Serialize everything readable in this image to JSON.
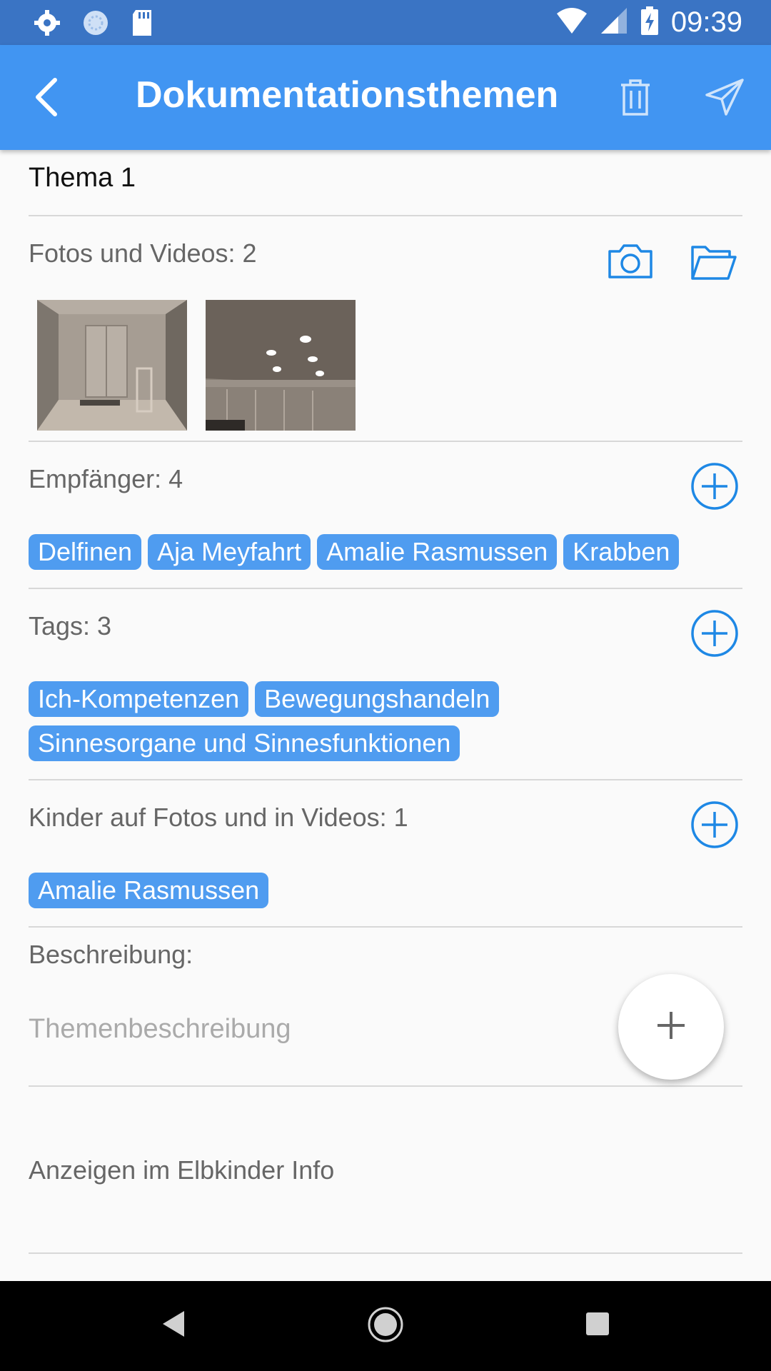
{
  "status_bar": {
    "time": "09:39",
    "icons": [
      "gear-icon",
      "sync-icon",
      "sdcard-icon",
      "wifi-icon",
      "signal-icon",
      "battery-charging-icon"
    ]
  },
  "app_bar": {
    "title": "Dokumentationsthemen",
    "icons": [
      "back-arrow-icon",
      "trash-icon",
      "send-icon"
    ]
  },
  "topic": {
    "title": "Thema 1"
  },
  "media": {
    "label": "Fotos und Videos: 2",
    "icons": [
      "camera-icon",
      "folder-icon"
    ]
  },
  "recipients": {
    "label": "Empfänger: 4",
    "chips": [
      "Delfinen",
      "Aja Meyfahrt",
      "Amalie Rasmussen",
      "Krabben"
    ]
  },
  "tags": {
    "label": "Tags: 3",
    "chips": [
      "Ich-Kompetenzen",
      "Bewegungshandeln",
      "Sinnesorgane und Sinnesfunktionen"
    ]
  },
  "children": {
    "label": "Kinder auf Fotos und in Videos: 1",
    "chips": [
      "Amalie Rasmussen"
    ]
  },
  "description": {
    "label": "Beschreibung:",
    "placeholder": "Themenbeschreibung"
  },
  "display": {
    "label": "Anzeigen im Elbkinder Info"
  },
  "colors": {
    "accent": "#4195f2",
    "chip": "#4f9cf0",
    "icon_blue": "#1e88e5",
    "status_bar": "#3a74c4"
  }
}
